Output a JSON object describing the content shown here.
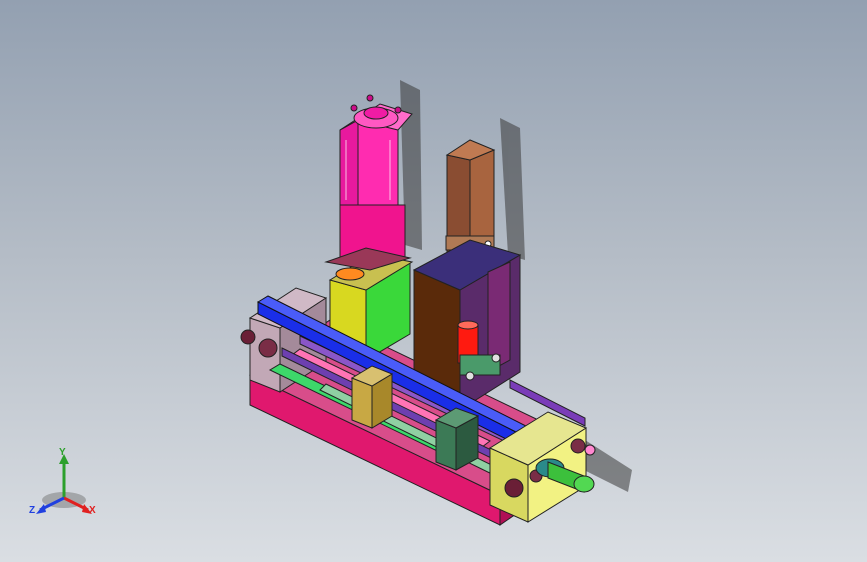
{
  "viewport": {
    "background_top": "#93a0b1",
    "background_bottom": "#dadee3"
  },
  "model": {
    "part_colors": {
      "pneumatic_cylinder": "#ff1aa6",
      "guide_cylinder": "#9b5a3a",
      "base_plate": "#e0186e",
      "cross_rail": "#1a2ee8",
      "end_block": "#f2f283",
      "shaft": "#4cc84c",
      "pin": "#ff1a10",
      "frame_plate": "#5a2b6a"
    }
  },
  "triad": {
    "y_label": "Y",
    "x_label": "X",
    "z_label": "Z",
    "y_color": "#2ca02c",
    "x_color": "#e02020",
    "z_color": "#2040e0"
  }
}
